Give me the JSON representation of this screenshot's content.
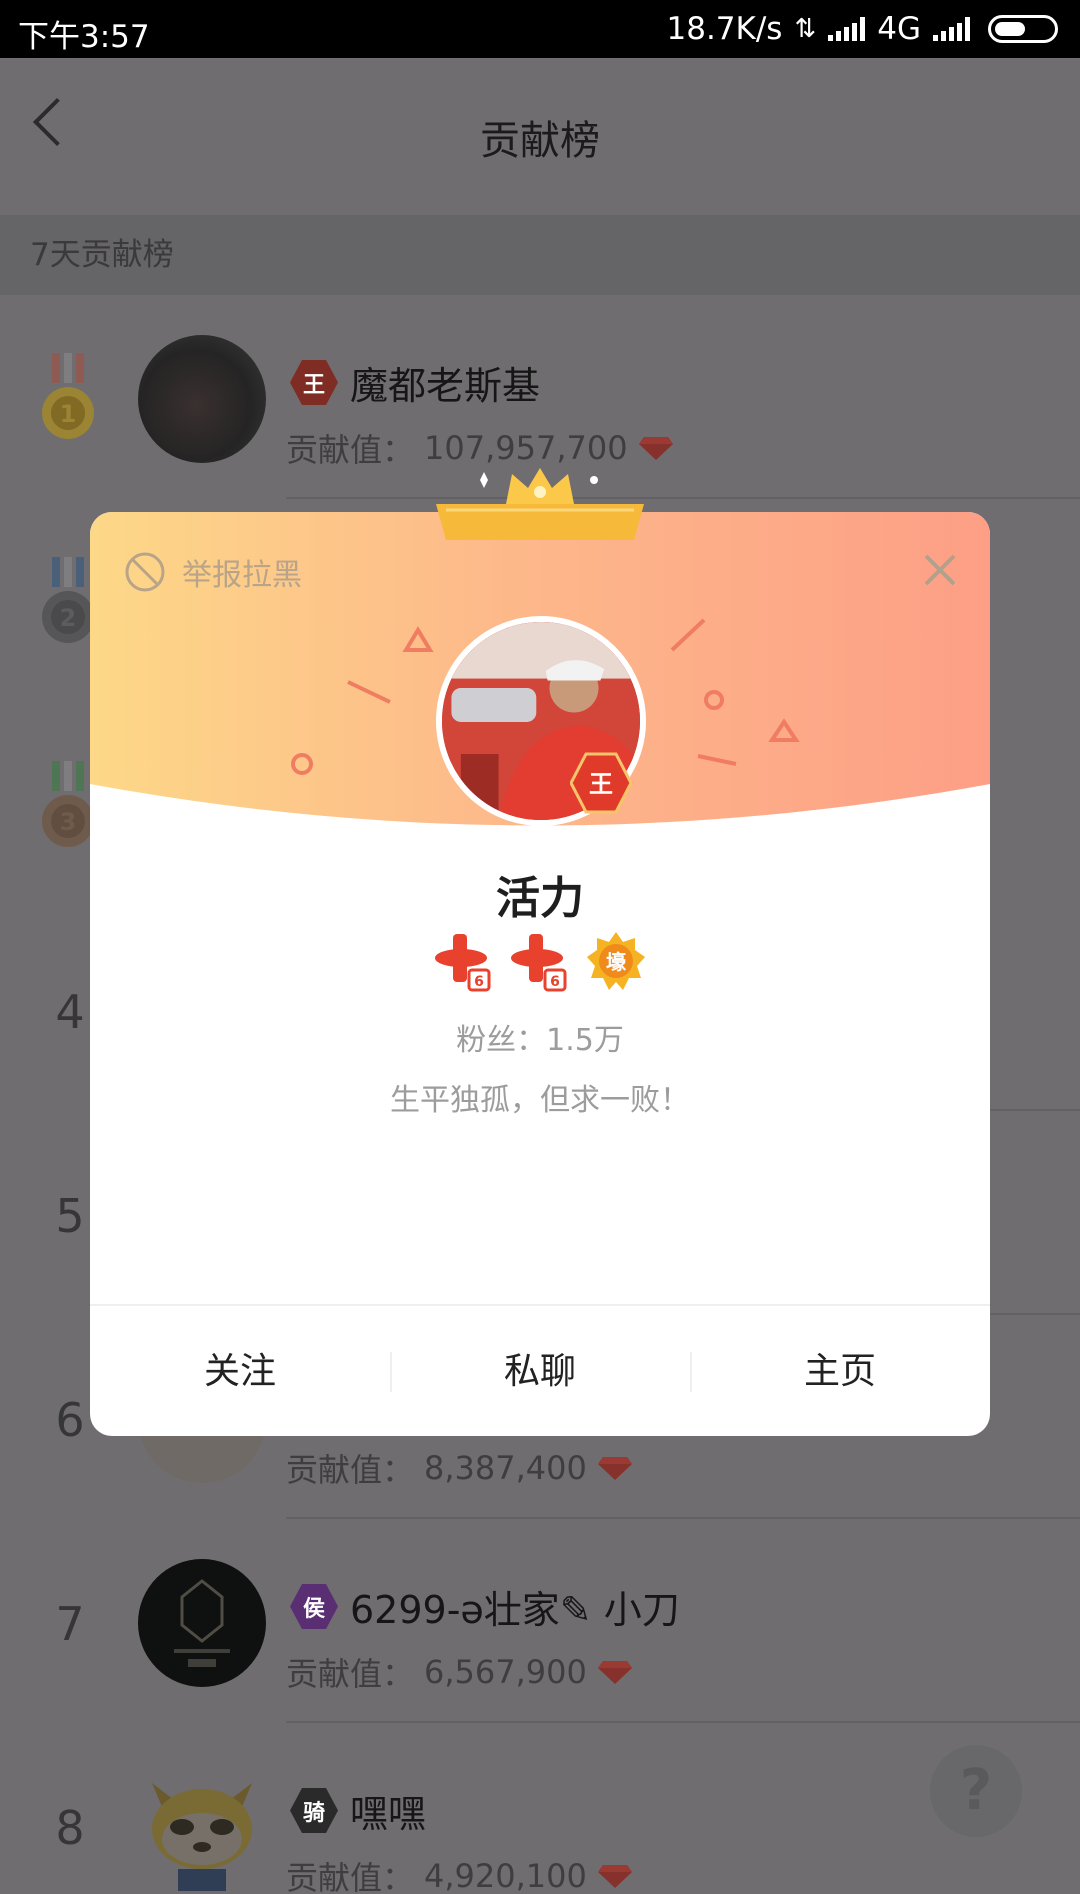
{
  "status_bar": {
    "time": "下午3:57",
    "speed": "18.7K/s",
    "network": "4G"
  },
  "header": {
    "title": "贡献榜"
  },
  "section": {
    "label": "7天贡献榜"
  },
  "list": [
    {
      "rank": "1",
      "name": "魔都老斯基",
      "badge": "王",
      "contrib_label": "贡献值：",
      "contrib": "107,957,700"
    },
    {
      "rank": "2"
    },
    {
      "rank": "3"
    },
    {
      "rank": "4"
    },
    {
      "rank": "5"
    },
    {
      "rank": "6",
      "contrib_label": "贡献值：",
      "contrib": "8,387,400"
    },
    {
      "rank": "7",
      "name": "6299-ə壮家✎ 小刀",
      "badge": "侯",
      "contrib_label": "贡献值：",
      "contrib": "6,567,900"
    },
    {
      "rank": "8",
      "name": "嘿嘿",
      "badge": "骑",
      "contrib_label": "贡献值：",
      "contrib": "4,920,100"
    }
  ],
  "help": {
    "label": "?"
  },
  "modal": {
    "report_label": "举报拉黑",
    "avatar_badge": "王",
    "name": "活力",
    "badge_third": "壕",
    "fans": "粉丝：1.5万",
    "signature": "生平独孤，但求一败！",
    "actions": {
      "follow": "关注",
      "chat": "私聊",
      "home": "主页"
    }
  },
  "colors": {
    "gem": "#e83a3a",
    "badge_king": "#c22f22",
    "badge_hou": "#8c3fb3",
    "badge_qi": "#3b3b3b",
    "modal_grad_left": "#fdd888",
    "modal_grad_right": "#fd9f86"
  }
}
